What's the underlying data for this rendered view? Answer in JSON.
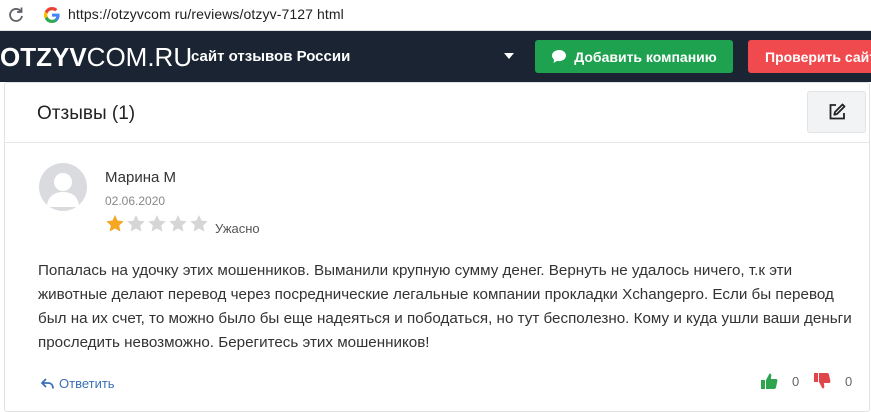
{
  "browser": {
    "url": "https://otzyvcom ru/reviews/otzyv-7127 html"
  },
  "header": {
    "logo_bold": "OTZYV",
    "logo_rest": "COM.RU",
    "tagline": "сайт отзывов России",
    "add_company_label": "Добавить компанию",
    "check_label": "Проверить сайт",
    "colors": {
      "bg": "#1b2433",
      "add": "#1ea24f",
      "check": "#f0494e"
    }
  },
  "reviews": {
    "title": "Отзывы (1)",
    "items": [
      {
        "author": "Марина М",
        "date": "02.06.2020",
        "rating": 1,
        "max_rating": 5,
        "rating_label": "Ужасно",
        "text": "Попалась на удочку этих мошенников. Выманили крупную сумму денег. Вернуть не удалось ничего, т.к эти животные делают перевод через посреднические легальные компании прокладки Xchangepro. Если бы перевод был на их счет, то можно было бы еще надеяться и пободаться, но тут бесполезно. Кому и куда ушли ваши деньги проследить невозможно. Берегитесь этих мошенников!",
        "reply_label": "Ответить",
        "likes": "0",
        "dislikes": "0"
      }
    ]
  }
}
